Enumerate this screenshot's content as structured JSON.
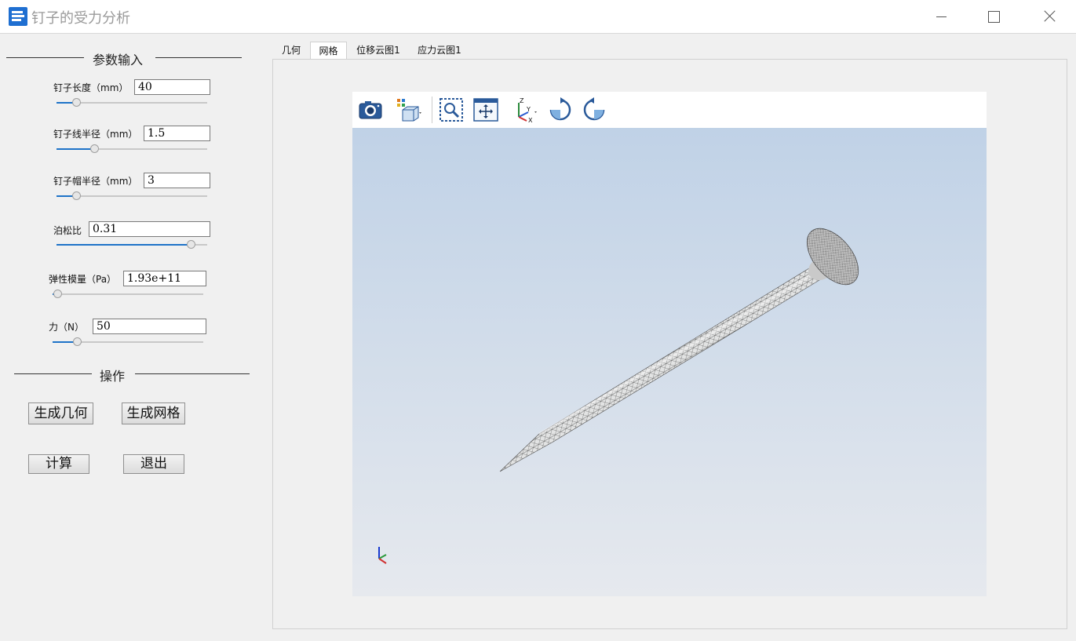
{
  "window": {
    "title": "钉子的受力分析",
    "icon": "app-icon"
  },
  "left_panel": {
    "params_header": "参数输入",
    "fields": [
      {
        "label": "钉子长度（mm）",
        "value": "40",
        "slider": 0.13
      },
      {
        "label": "钉子线半径（mm）",
        "value": "1.5",
        "slider": 0.25
      },
      {
        "label": "钉子帽半径（mm）",
        "value": "3",
        "slider": 0.13
      },
      {
        "label": "泊松比",
        "value": "0.31",
        "slider": 0.89
      },
      {
        "label": "弹性模量（Pa）",
        "value": "1.93e+11",
        "slider": 0.03
      },
      {
        "label": "力（N）",
        "value": "50",
        "slider": 0.16
      }
    ],
    "ops_header": "操作",
    "buttons": {
      "gen_geometry": "生成几何",
      "gen_mesh": "生成网格",
      "compute": "计算",
      "exit": "退出"
    }
  },
  "tabs": [
    {
      "label": "几何",
      "active": false
    },
    {
      "label": "网格",
      "active": true
    },
    {
      "label": "位移云图1",
      "active": false
    },
    {
      "label": "应力云图1",
      "active": false
    }
  ],
  "viewer": {
    "toolbar_icons": [
      "camera-icon",
      "view-cube-icon",
      "zoom-box-icon",
      "fit-all-icon",
      "axes-orientation-icon",
      "rotate-clockwise-icon",
      "rotate-counterclockwise-icon"
    ],
    "axis_labels": {
      "z": "Z",
      "y": "Y",
      "x": "X"
    },
    "background_top": "#bdd0e6",
    "background_bottom": "#e6e9ee",
    "accent": "#1e73c8"
  }
}
